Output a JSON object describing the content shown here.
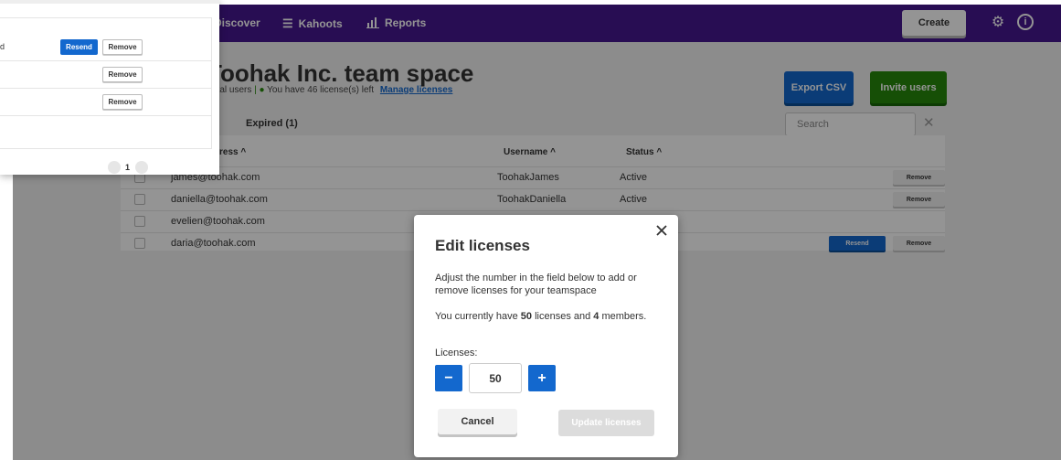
{
  "nav": {
    "discover": "Discover",
    "kahoots": "Kahoots",
    "reports": "Reports",
    "create": "Create",
    "discover_icon": "compass-icon",
    "kahoots_icon": "list-icon",
    "reports_icon": "bar-chart-icon",
    "settings_icon": "gear-icon",
    "info_icon": "info-icon"
  },
  "header": {
    "title": "Toohak Inc. team space",
    "total_users": "Total users",
    "licenses_left": "You have 46 license(s) left",
    "manage_link": "Manage licenses",
    "export_button": "Export CSV",
    "invite_button": "Invite users"
  },
  "tabs": {
    "active_fragment": ")",
    "expired": "Expired (1)"
  },
  "search": {
    "placeholder": "Search",
    "clear_icon": "close-icon"
  },
  "table": {
    "headers": {
      "email": "ress ^",
      "username": "Username ^",
      "status": "Status ^"
    },
    "rows": [
      {
        "email": "james@toohak.com",
        "username": "ToohakJames",
        "status": "Active",
        "remove": "Remove",
        "resend": ""
      },
      {
        "email": "daniella@toohak.com",
        "username": "ToohakDaniella",
        "status": "Active",
        "remove": "Remove",
        "resend": ""
      },
      {
        "email": "evelien@toohak.com",
        "username": "",
        "status": "",
        "remove": "",
        "resend": ""
      },
      {
        "email": "daria@toohak.com",
        "username": "",
        "status": "",
        "remove": "Remove",
        "resend": "Resend"
      }
    ]
  },
  "panel": {
    "rows": [
      {
        "text": "d",
        "resend": "Resend",
        "remove": "Remove"
      },
      {
        "text": "",
        "resend": "",
        "remove": "Remove"
      },
      {
        "text": "",
        "resend": "",
        "remove": "Remove"
      }
    ],
    "page": "1"
  },
  "modal": {
    "title": "Edit licenses",
    "close_icon": "close-icon",
    "description": "Adjust the number in the field below to add or remove licenses for your teamspace",
    "current_prefix": "You currently have ",
    "current_licenses": "50",
    "current_middle": " licenses and ",
    "current_members": "4",
    "current_suffix": " members.",
    "licenses_label": "Licenses:",
    "licenses_value": "50",
    "minus": "−",
    "plus": "+",
    "cancel": "Cancel",
    "update": "Update licenses"
  },
  "colors": {
    "brand_purple": "#46178f",
    "primary_blue": "#1368ce",
    "success_green": "#26890c"
  }
}
